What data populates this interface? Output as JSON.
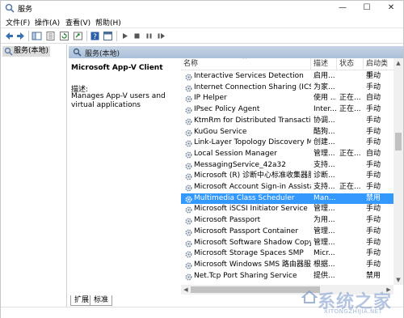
{
  "window": {
    "title": "服务",
    "minimize": "—",
    "maximize": "☐",
    "close": "✕"
  },
  "menu": {
    "file": "文件(F)",
    "action": "操作(A)",
    "view": "查看(V)",
    "help": "帮助(H)"
  },
  "tree": {
    "item": "服务(本地)"
  },
  "pane": {
    "header": "服务(本地)"
  },
  "description": {
    "service_name": "Microsoft App-V Client",
    "label": "描述:",
    "text": "Manages App-V users and virtual applications"
  },
  "columns": {
    "name": "名称",
    "desc": "描述",
    "status": "状态",
    "startup": "启动类型"
  },
  "services": [
    {
      "name": "Interactive Services Detection",
      "desc": "启用...",
      "status": "",
      "startup": "手动"
    },
    {
      "name": "Internet Connection Sharing (ICS)",
      "desc": "为家...",
      "status": "",
      "startup": "手动"
    },
    {
      "name": "IP Helper",
      "desc": "使用 ...",
      "status": "正在...",
      "startup": "自动"
    },
    {
      "name": "IPsec Policy Agent",
      "desc": "Inter...",
      "status": "正在...",
      "startup": "手动"
    },
    {
      "name": "KtmRm for Distributed Transaction ...",
      "desc": "协调...",
      "status": "",
      "startup": "手动"
    },
    {
      "name": "KuGou Service",
      "desc": "酷狗...",
      "status": "",
      "startup": "手动"
    },
    {
      "name": "Link-Layer Topology Discovery Ma...",
      "desc": "创建...",
      "status": "",
      "startup": "手动"
    },
    {
      "name": "Local Session Manager",
      "desc": "管理...",
      "status": "正在...",
      "startup": "自动"
    },
    {
      "name": "MessagingService_42a32",
      "desc": "支持...",
      "status": "",
      "startup": "手动"
    },
    {
      "name": "Microsoft (R) 诊断中心标准收集器服务",
      "desc": "诊断...",
      "status": "",
      "startup": "手动"
    },
    {
      "name": "Microsoft Account Sign-in Assistant",
      "desc": "支持...",
      "status": "正在...",
      "startup": "手动"
    },
    {
      "name": "Multimedia Class Scheduler",
      "desc": "Man...",
      "status": "",
      "startup": "禁用",
      "selected": true
    },
    {
      "name": "Microsoft iSCSI Initiator Service",
      "desc": "管理...",
      "status": "",
      "startup": "手动"
    },
    {
      "name": "Microsoft Passport",
      "desc": "为用...",
      "status": "",
      "startup": "手动"
    },
    {
      "name": "Microsoft Passport Container",
      "desc": "管理...",
      "status": "",
      "startup": "手动"
    },
    {
      "name": "Microsoft Software Shadow Copy P...",
      "desc": "管理...",
      "status": "",
      "startup": "手动"
    },
    {
      "name": "Microsoft Storage Spaces SMP",
      "desc": "Micr...",
      "status": "",
      "startup": "手动"
    },
    {
      "name": "Microsoft Windows SMS 路由器服务...",
      "desc": "根据...",
      "status": "",
      "startup": "手动"
    },
    {
      "name": "Net.Tcp Port Sharing Service",
      "desc": "提供...",
      "status": "",
      "startup": "禁用"
    }
  ],
  "tabs": {
    "extended": "扩展",
    "standard": "标准"
  },
  "watermark": {
    "main": "系统之家",
    "sub": "XITONGZHIJIA.NET"
  },
  "colors": {
    "selection": "#3399ff",
    "pane_header": "#b8cadf"
  }
}
